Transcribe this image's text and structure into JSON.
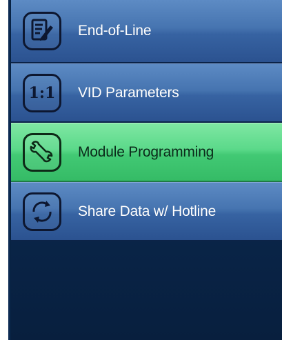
{
  "menu": {
    "items": [
      {
        "label": "End-of-Line",
        "icon": "edit-document-icon",
        "state": "normal"
      },
      {
        "label": "VID Parameters",
        "icon": "ratio-icon",
        "icon_text": "1:1",
        "state": "normal"
      },
      {
        "label": "Module Programming",
        "icon": "wrench-icon",
        "state": "selected"
      },
      {
        "label": "Share Data w/ Hotline",
        "icon": "sync-icon",
        "state": "normal"
      }
    ]
  },
  "colors": {
    "item_blue": "#4674b0",
    "item_selected_green": "#5bd98a",
    "panel_navy": "#0a274c",
    "icon_stroke": "#0d1730"
  }
}
